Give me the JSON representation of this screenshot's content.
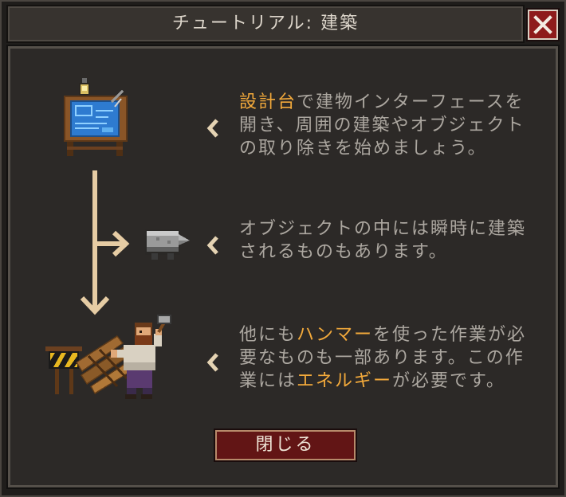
{
  "window": {
    "title": "チュートリアル: 建築",
    "close_icon": "close-icon"
  },
  "steps": [
    {
      "icon": "blueprint-table-icon",
      "pointer_icon": "chevron-left-icon",
      "lines": [
        [
          {
            "text": "設計台",
            "highlight": true
          },
          {
            "text": "で建物インターフェースを",
            "highlight": false
          }
        ],
        [
          {
            "text": "開き、周囲の建築やオブジェクト",
            "highlight": false
          }
        ],
        [
          {
            "text": "の取り除きを始めましょう。",
            "highlight": false
          }
        ]
      ]
    },
    {
      "icon": "stone-block-icon",
      "pointer_icon": "chevron-left-icon",
      "lines": [
        [
          {
            "text": "オブジェクトの中には瞬時に建築",
            "highlight": false
          }
        ],
        [
          {
            "text": "されるものもあります。",
            "highlight": false
          }
        ]
      ]
    },
    {
      "icon": "worker-hammer-icon",
      "pointer_icon": "chevron-left-icon",
      "lines": [
        [
          {
            "text": "他にも",
            "highlight": false
          },
          {
            "text": "ハンマー",
            "highlight": true
          },
          {
            "text": "を使った作業が必",
            "highlight": false
          }
        ],
        [
          {
            "text": "要なものも一部あります。この作",
            "highlight": false
          }
        ],
        [
          {
            "text": "業には",
            "highlight": false
          },
          {
            "text": "エネルギー",
            "highlight": true
          },
          {
            "text": "が必要です。",
            "highlight": false
          }
        ]
      ]
    }
  ],
  "flow_arrows": {
    "icon": "flow-arrow-icon"
  },
  "close_button": {
    "label": "閉じる"
  },
  "colors": {
    "text": "#aca7a0",
    "highlight": "#f2a93b",
    "close_red": "#8e1b1b",
    "arrow": "#e6cca4",
    "chevron": "#e5d3b3"
  }
}
